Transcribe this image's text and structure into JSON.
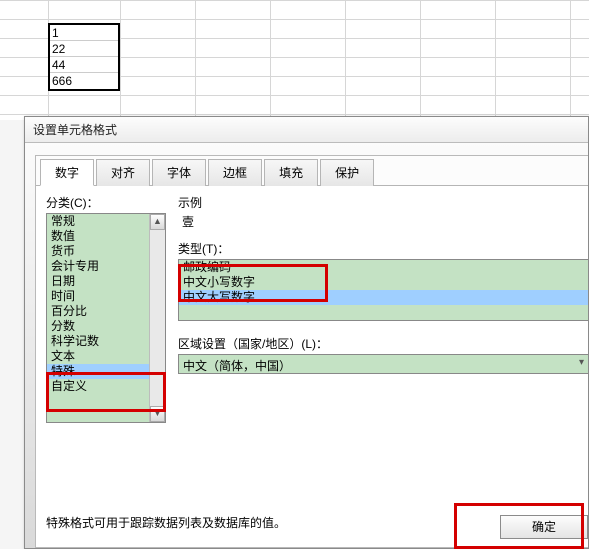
{
  "cells": [
    "1",
    "22",
    "44",
    "666"
  ],
  "sheet_vlines": [
    48,
    120,
    195,
    270,
    345,
    420,
    495,
    570
  ],
  "dialog": {
    "title": "设置单元格格式",
    "tabs": [
      {
        "label": "数字",
        "active": true
      },
      {
        "label": "对齐",
        "active": false
      },
      {
        "label": "字体",
        "active": false
      },
      {
        "label": "边框",
        "active": false
      },
      {
        "label": "填充",
        "active": false
      },
      {
        "label": "保护",
        "active": false
      }
    ],
    "category_label": "分类(C)：",
    "categories": [
      "常规",
      "数值",
      "货币",
      "会计专用",
      "日期",
      "时间",
      "百分比",
      "分数",
      "科学记数",
      "文本",
      "特殊",
      "自定义"
    ],
    "category_selected_index": 10,
    "sample_label": "示例",
    "sample_value": "壹",
    "type_label": "类型(T)：",
    "types": [
      "邮政编码",
      "中文小写数字",
      "中文大写数字"
    ],
    "type_selected_index": 2,
    "locale_label": "区域设置（国家/地区）(L)：",
    "locale_value": "中文（简体，中国）",
    "description": "特殊格式可用于跟踪数据列表及数据库的值。",
    "ok_label": "确定"
  }
}
